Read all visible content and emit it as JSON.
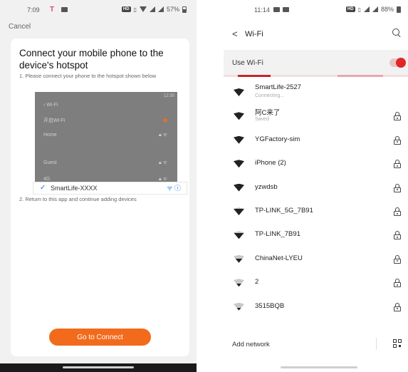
{
  "left": {
    "status_bar": {
      "time": "7:09",
      "t_icon": "T",
      "hd": "HD",
      "battery": "57%"
    },
    "cancel_label": "Cancel",
    "title": "Connect your mobile phone to the device's hotspot",
    "step1": "1. Please connect your phone to the hotspot shown below",
    "mock": {
      "time": "12:30",
      "back_label": "Wi-Fi",
      "toggle_label": "开启Wi-Fi",
      "rows": [
        "Home",
        "Guest",
        "4G"
      ],
      "selected_network": "SmartLife-XXXX",
      "selected_icons": "ᯤ ⓘ"
    },
    "step2": "2. Return to this app and continue adding devices",
    "connect_button": "Go to Connect",
    "accent_color": "#f26b1d"
  },
  "right": {
    "status_bar": {
      "time": "11:14",
      "hd": "HD",
      "battery": "88%"
    },
    "back_glyph": "<",
    "title": "Wi-Fi",
    "use_wifi_label": "Use Wi-Fi",
    "use_wifi_on": true,
    "networks": [
      {
        "name": "SmartLife-2527",
        "status": "Connecting...",
        "secured": false,
        "signal": 4
      },
      {
        "name": "阿C来了",
        "status": "Saved",
        "secured": true,
        "signal": 4
      },
      {
        "name": "YGFactory-sim",
        "status": "",
        "secured": true,
        "signal": 4
      },
      {
        "name": "iPhone (2)",
        "status": "",
        "secured": true,
        "signal": 4
      },
      {
        "name": "yzwdsb",
        "status": "",
        "secured": true,
        "signal": 4
      },
      {
        "name": "TP-LINK_5G_7B91",
        "status": "",
        "secured": true,
        "signal": 3
      },
      {
        "name": "TP-LINK_7B91",
        "status": "",
        "secured": true,
        "signal": 3
      },
      {
        "name": "ChinaNet-LYEU",
        "status": "",
        "secured": true,
        "signal": 2
      },
      {
        "name": "2",
        "status": "",
        "secured": true,
        "signal": 1
      },
      {
        "name": "3515BQB",
        "status": "",
        "secured": true,
        "signal": 1
      }
    ],
    "add_network_label": "Add network",
    "toggle_color": "#e02626"
  }
}
